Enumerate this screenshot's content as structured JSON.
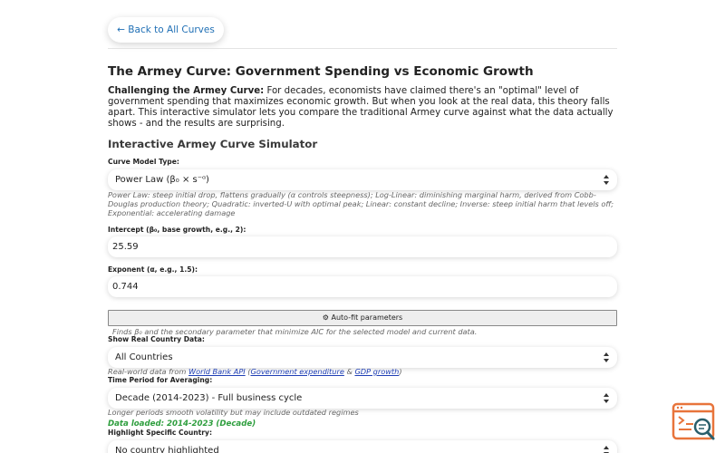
{
  "nav": {
    "back_label": "← Back to All Curves"
  },
  "page": {
    "title": "The Armey Curve: Government Spending vs Economic Growth",
    "intro_bold": "Challenging the Armey Curve:",
    "intro_text": " For decades, economists have claimed there's an \"optimal\" level of government spending that maximizes economic growth. But when you look at the real data, this theory falls apart. This interactive simulator lets you compare the traditional Armey curve against what the data actually shows - and the results are surprising.",
    "section_title": "Interactive Armey Curve Simulator"
  },
  "form": {
    "model_type": {
      "label": "Curve Model Type:",
      "value": "Power Law (β₀ × s⁻ᵅ)",
      "hint": "Power Law: steep initial drop, flattens gradually (α controls steepness); Log-Linear: diminishing marginal harm, derived from Cobb-Douglas production theory; Quadratic: inverted-U with optimal peak; Linear: constant decline; Inverse: steep initial harm that levels off; Exponential: accelerating damage"
    },
    "intercept": {
      "label": "Intercept (β₀, base growth, e.g., 2):",
      "value": "25.59"
    },
    "exponent": {
      "label": "Exponent (α, e.g., 1.5):",
      "value": "0.744"
    },
    "autofit": {
      "label": "⚙ Auto-fit parameters",
      "hint": "Finds β₀ and the secondary parameter that minimize AIC for the selected model and current data."
    },
    "country_data": {
      "label": "Show Real Country Data:",
      "value": "All Countries",
      "hint_prefix": "Real-world data from ",
      "link_worldbank": "World Bank API",
      "hint_open": " (",
      "link_govexp": "Government expenditure",
      "hint_amp": " & ",
      "link_gdp": "GDP growth",
      "hint_close": ")"
    },
    "time_period": {
      "label": "Time Period for Averaging:",
      "value": "Decade (2014-2023) - Full business cycle",
      "hint": "Longer periods smooth volatility but may include outdated regimes",
      "status": "Data loaded: 2014-2023 (Decade)"
    },
    "highlight": {
      "label": "Highlight Specific Country:",
      "value": "No country highlighted"
    }
  },
  "colors": {
    "accent": "#1f6fb5",
    "success": "#2e9e3e",
    "widget": "#e8743b"
  },
  "icons": {
    "widget": "search-feedback-icon"
  }
}
